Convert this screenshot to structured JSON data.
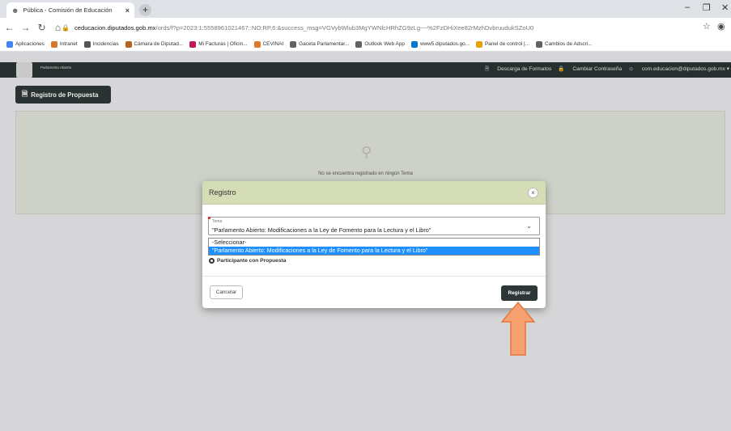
{
  "browser": {
    "tab_title": "Pública - Comisión de Educación",
    "tab_close": "×",
    "new_tab": "+",
    "url_host": "ceducacion.diputados.gob.mx",
    "url_path": "/ords/f?p=2023:1:5558961021467::NO:RP,6:&success_msg=VGVybWlub3MgYWNlcHRhZG9zLg~~%2FzDHiXee82rMzhDvbruudukSZoU0",
    "bookmarks": [
      "Aplicaciones",
      "Intranet",
      "Incidencias",
      "Cámara de Diputad...",
      "Mi Facturas | Oficin...",
      "CEVINAI",
      "Gaceta Parlamentar...",
      "Outlook Web App",
      "www5.diputados.go...",
      "Panel de control |...",
      "Cambios de Adscri..."
    ],
    "bookmark_colors": [
      "#4285f4",
      "#d8742b",
      "#555555",
      "#b5651d",
      "#c2185b",
      "#e0792a",
      "#5f6368",
      "#5f6368",
      "#0078d4",
      "#e6a100",
      "#5f6368",
      "#1a73e8"
    ]
  },
  "header": {
    "logo_text": "Parlamento Abierto",
    "links": [
      "Descarga de Formatos",
      "Cambiar Contraseña",
      "com.educacion@diputados.gob.mx"
    ]
  },
  "page": {
    "register_button": "Registro de Propuesta",
    "empty_message": "No se encuentra registrado en ningún Tema"
  },
  "modal": {
    "title": "Registro",
    "close": "×",
    "field_label": "Tema",
    "selected_value": "\"Parlamento Abierto: Modificaciones a la Ley de Fomento para la Lectura y el Libro\"",
    "options": [
      "-Seleccionar-",
      "\"Parlamento Abierto: Modificaciones a la Ley de Fomento para la Lectura y el Libro\""
    ],
    "radio_label": "Participante con Propuesta",
    "cancel_label": "Cancelar",
    "submit_label": "Registrar"
  },
  "colors": {
    "header_bg": "#2c3333",
    "modal_header_bg": "#d4ddb5",
    "option_highlight": "#1e90ff",
    "arrow_fill": "#f7a072",
    "arrow_stroke": "#e8763a"
  }
}
